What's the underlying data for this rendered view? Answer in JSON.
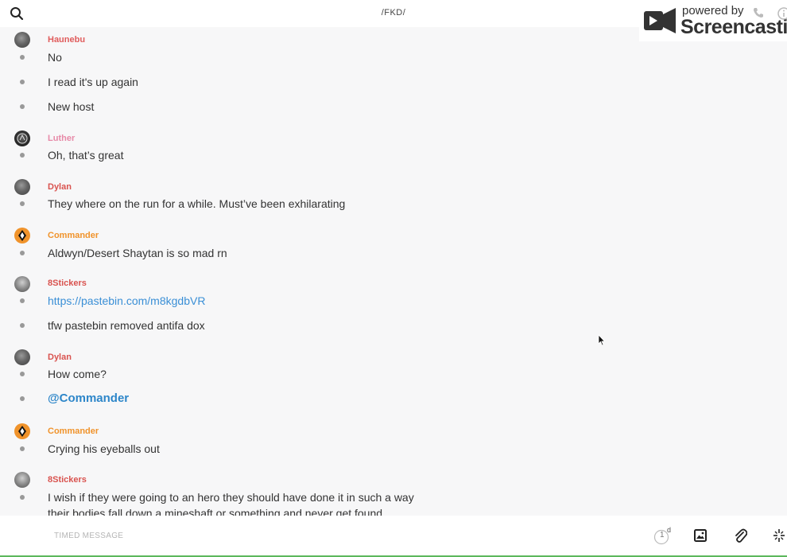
{
  "header": {
    "title": "/FKD/",
    "search_icon": "search-icon"
  },
  "watermark": {
    "powered_by": "powered by",
    "brand": "Screencastify"
  },
  "colors": {
    "haunebu": "#e05c5c",
    "luther": "#e78aa8",
    "dylan": "#d9534f",
    "commander": "#f0932b",
    "stickers": "#d9534f",
    "link": "#3a8fd6"
  },
  "messages": [
    {
      "user": "Haunebu",
      "lines": [
        "No",
        "I read it's up again",
        "New host"
      ]
    },
    {
      "user": "Luther",
      "lines": [
        "Oh, that’s great"
      ]
    },
    {
      "user": "Dylan",
      "lines": [
        "They where on the run for a while. Must’ve been exhilarating"
      ]
    },
    {
      "user": "Commander",
      "lines": [
        "Aldwyn/Desert Shaytan is so mad rn"
      ]
    },
    {
      "user": "8Stickers",
      "lines": [
        "https://pastebin.com/m8kgdbVR",
        "tfw pastebin removed antifa dox"
      ]
    },
    {
      "user": "Dylan",
      "lines": [
        "How come?",
        "@Commander"
      ]
    },
    {
      "user": "Commander",
      "lines": [
        "Crying his eyeballs out"
      ]
    },
    {
      "user": "8Stickers",
      "lines": [
        "I wish if they were going to an hero they should have done it in such a way",
        "their bodies fall down a mineshaft or something and never get found"
      ]
    }
  ],
  "footer": {
    "placeholder": "TIMED MESSAGE",
    "timer_value": "1",
    "timer_unit": "d",
    "icons": [
      "timer-icon",
      "image-icon",
      "paperclip-icon",
      "sparkle-icon"
    ]
  }
}
